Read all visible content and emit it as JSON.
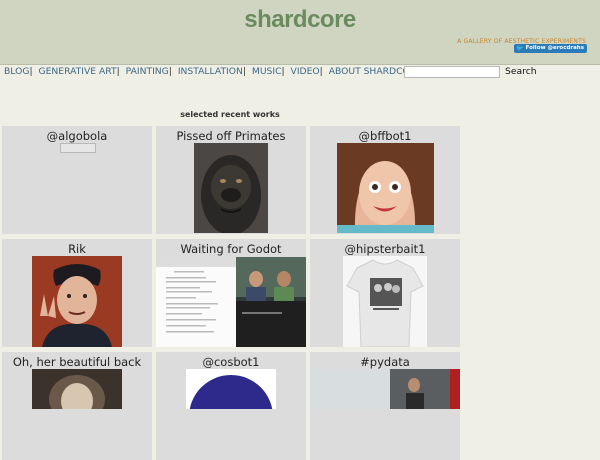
{
  "header": {
    "logo": "shardcore",
    "tagline": "A GALLERY OF AESTHETIC EXPERIMENTS",
    "follow_label": "Follow @erocdrahs"
  },
  "nav": {
    "items": [
      "BLOG",
      "GENERATIVE ART",
      "PAINTING",
      "INSTALLATION",
      "MUSIC",
      "VIDEO",
      "ABOUT SHARDCORE"
    ],
    "search_value": "",
    "search_button": "Search"
  },
  "section_title": "selected recent works",
  "works": [
    {
      "title": "@algobola"
    },
    {
      "title": "Pissed off Primates"
    },
    {
      "title": "@bffbot1"
    },
    {
      "title": "Rik"
    },
    {
      "title": "Waiting for Godot"
    },
    {
      "title": "@hipsterbait1"
    },
    {
      "title": "Oh, her beautiful back"
    },
    {
      "title": "@cosbot1"
    },
    {
      "title": "#pydata"
    }
  ],
  "colors": {
    "header_bg": "#d0d5c2",
    "logo": "#6a8b5e",
    "tagline": "#c5832a",
    "nav_link": "#3d6786",
    "page_bg": "#efefe6",
    "tile_bg": "#dcdcdc",
    "follow_button": "#2b7bb9"
  }
}
